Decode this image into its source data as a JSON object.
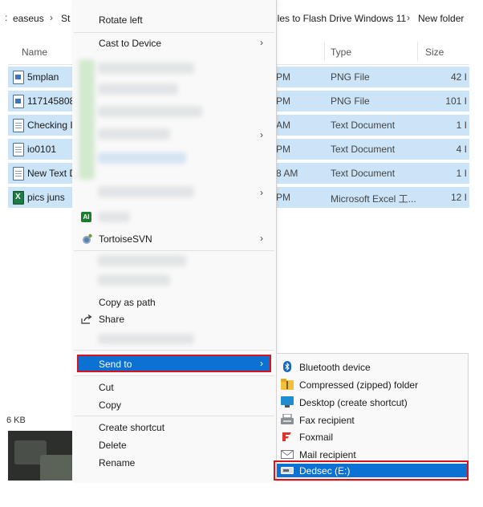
{
  "breadcrumb": {
    "items": [
      "easeus",
      "St",
      "iles to Flash Drive Windows 11",
      "New folder"
    ]
  },
  "columns": {
    "name": "Name",
    "type": "Type",
    "size": "Size"
  },
  "files": [
    {
      "name": "5mplan",
      "time": "PM",
      "type": "PNG File",
      "size": "42 I",
      "icon": "image-file-icon"
    },
    {
      "name": "117145808",
      "time": "PM",
      "type": "PNG File",
      "size": "101 I",
      "icon": "image-file-icon"
    },
    {
      "name": "Checking I",
      "time": "AM",
      "type": "Text Document",
      "size": "1 I",
      "icon": "text-file-icon"
    },
    {
      "name": "io0101",
      "time": "PM",
      "type": "Text Document",
      "size": "4 I",
      "icon": "text-file-icon"
    },
    {
      "name": "New Text D",
      "time": "8 AM",
      "type": "Text Document",
      "size": "1 I",
      "icon": "text-file-icon"
    },
    {
      "name": "pics juns",
      "time": "PM",
      "type": "Microsoft Excel 工...",
      "size": "12 I",
      "icon": "excel-file-icon"
    }
  ],
  "status": {
    "size_text": "6 KB"
  },
  "context_menu": {
    "rotate_left": "Rotate left",
    "cast_to_device": "Cast to Device",
    "tortoise_svn": "TortoiseSVN",
    "ai_badge": "AI",
    "copy_as_path": "Copy as path",
    "share": "Share",
    "send_to": "Send to",
    "cut": "Cut",
    "copy": "Copy",
    "create_shortcut": "Create shortcut",
    "delete": "Delete",
    "rename": "Rename",
    "chevron": "›"
  },
  "send_to_menu": {
    "bluetooth": "Bluetooth device",
    "compressed": "Compressed (zipped) folder",
    "desktop": "Desktop (create shortcut)",
    "fax": "Fax recipient",
    "foxmail": "Foxmail",
    "mail": "Mail recipient",
    "dedsec": "Dedsec (E:)"
  },
  "colors": {
    "selection_row": "#cce4f7",
    "highlight": "#0b72d3",
    "annotation_red": "#d7141e"
  }
}
